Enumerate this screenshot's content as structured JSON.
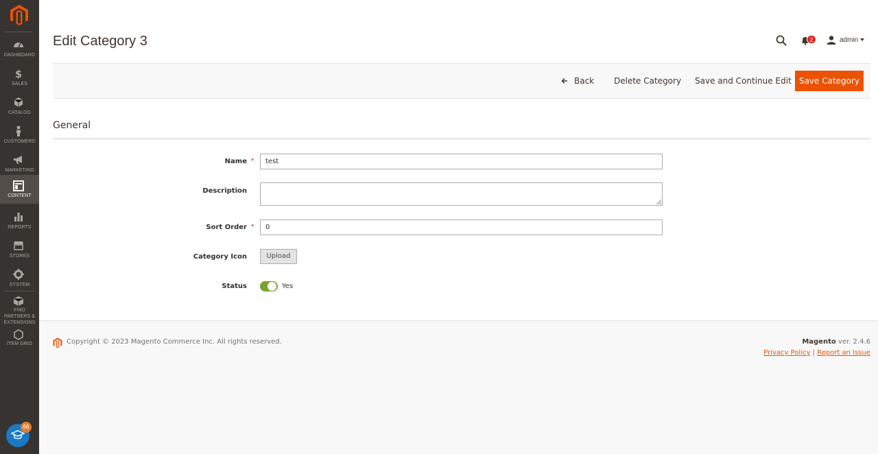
{
  "sidebar": {
    "items": [
      {
        "label": "DASHBOARD",
        "icon": "dashboard-icon"
      },
      {
        "label": "SALES",
        "icon": "dollar-icon"
      },
      {
        "label": "CATALOG",
        "icon": "cube-icon"
      },
      {
        "label": "CUSTOMERS",
        "icon": "person-icon"
      },
      {
        "label": "MARKETING",
        "icon": "megaphone-icon"
      },
      {
        "label": "CONTENT",
        "icon": "layout-icon",
        "active": true
      },
      {
        "label": "REPORTS",
        "icon": "bar-chart-icon"
      },
      {
        "label": "STORES",
        "icon": "store-icon"
      },
      {
        "label": "SYSTEM",
        "icon": "gear-icon"
      },
      {
        "label": "FIND PARTNERS & EXTENSIONS",
        "icon": "box-icon"
      },
      {
        "label": "ITEM GRID",
        "icon": "hexagon-icon"
      }
    ],
    "learn_badge": "66"
  },
  "header": {
    "title": "Edit Category 3",
    "notification_count": "2",
    "user": "admin"
  },
  "actions": {
    "back": "Back",
    "delete": "Delete Category",
    "save_continue": "Save and Continue Edit",
    "save": "Save Category"
  },
  "form": {
    "section_title": "General",
    "name_label": "Name",
    "name_value": "test",
    "description_label": "Description",
    "description_value": "",
    "sort_order_label": "Sort Order",
    "sort_order_value": "0",
    "icon_label": "Category Icon",
    "upload_label": "Upload",
    "status_label": "Status",
    "status_value": "Yes",
    "required_mark": "*"
  },
  "footer": {
    "copyright": "Copyright © 2023 Magento Commerce Inc. All rights reserved.",
    "brand": "Magento",
    "version": "ver. 2.4.6",
    "privacy": "Privacy Policy",
    "separator": "|",
    "report": "Report an Issue"
  },
  "colors": {
    "sidebar_bg": "#373330",
    "accent": "#eb5202",
    "toggle_on": "#79a22e"
  }
}
